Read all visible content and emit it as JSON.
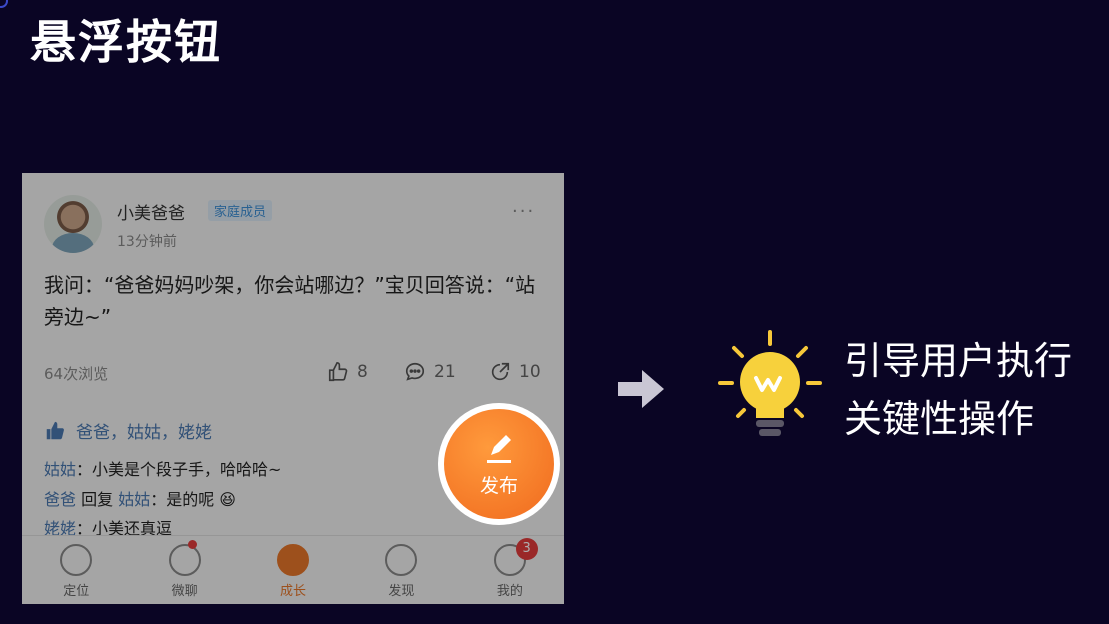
{
  "slide": {
    "title": "悬浮按钮"
  },
  "post": {
    "user_name": "小美爸爸",
    "badge": "家庭成员",
    "time": "13分钟前",
    "more": "···",
    "text": "我问：“爸爸妈妈吵架，你会站哪边？”宝贝回答说：“站旁边~”",
    "views": "64次浏览",
    "likes": "8",
    "comments": "21",
    "shares": "10",
    "liked_by": "爸爸，姑姑，姥姥"
  },
  "comments": [
    {
      "who": "姑姑",
      "text": "：小美是个段子手，哈哈哈~"
    },
    {
      "who": "爸爸",
      "reply": " 回复 ",
      "to": "姑姑",
      "text": "：是的呢 😆"
    },
    {
      "who": "姥姥",
      "text": "：小美还真逗"
    }
  ],
  "tabs": [
    {
      "label": "定位",
      "icon": "location-icon"
    },
    {
      "label": "微聊",
      "icon": "chat-icon"
    },
    {
      "label": "成长",
      "icon": "growth-icon"
    },
    {
      "label": "发现",
      "icon": "compass-icon"
    },
    {
      "label": "我的",
      "icon": "smile-icon"
    }
  ],
  "badge_count": "3",
  "fab": {
    "label": "发布",
    "icon": "edit-icon"
  },
  "right": {
    "line1": "引导用户执行",
    "line2": "关键性操作"
  },
  "colors": {
    "accent": "#f06a1e",
    "link": "#4a78b0",
    "background": "#0a0524"
  }
}
